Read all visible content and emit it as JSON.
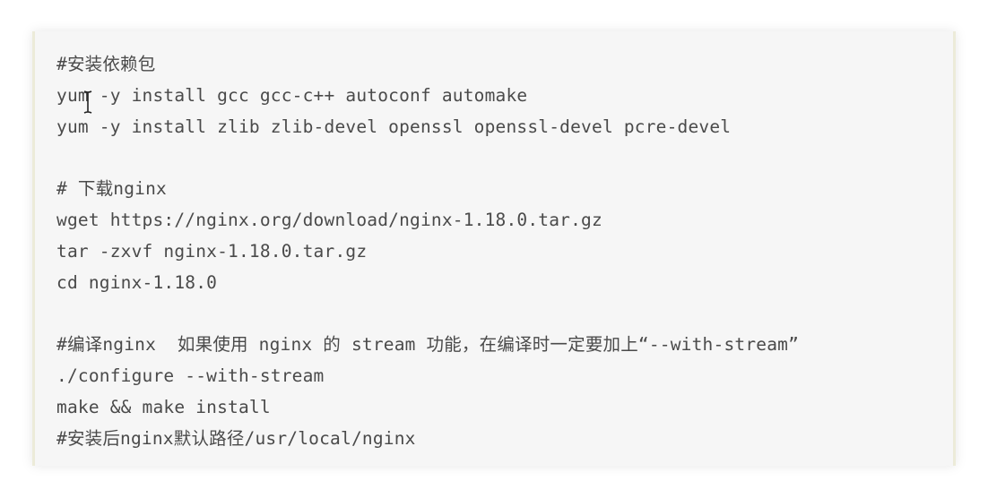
{
  "code_block": {
    "lines": [
      "#安装依赖包",
      "yum -y install gcc gcc-c++ autoconf automake",
      "yum -y install zlib zlib-devel openssl openssl-devel pcre-devel",
      "",
      "# 下载nginx",
      "wget https://nginx.org/download/nginx-1.18.0.tar.gz",
      "tar -zxvf nginx-1.18.0.tar.gz",
      "cd nginx-1.18.0",
      "",
      "#编译nginx  如果使用 nginx 的 stream 功能，在编译时一定要加上“--with-stream”",
      "./configure --with-stream",
      "make && make install",
      "#安装后nginx默认路径/usr/local/nginx"
    ]
  },
  "colors": {
    "background": "#ffffff",
    "code_background": "#f6f6f6",
    "code_text": "#4a4a4a",
    "border_accent": "#ecebd9"
  },
  "icons": {
    "cursor": "text-cursor-icon"
  }
}
